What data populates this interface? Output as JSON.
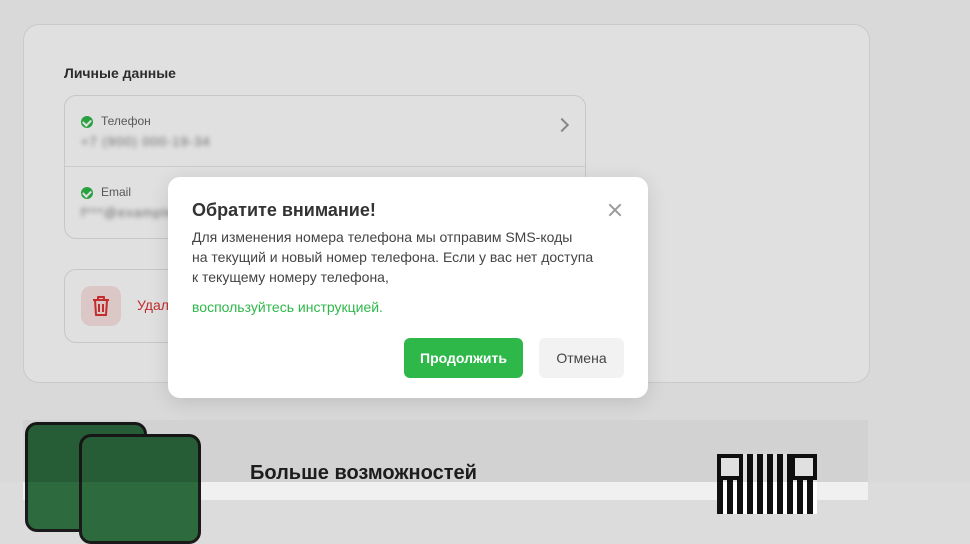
{
  "profile": {
    "section_title": "Личные данные",
    "phone": {
      "label": "Телефон",
      "value": "+7 (900) 000-19-34"
    },
    "email": {
      "label": "Email",
      "value": "f***@example.com"
    },
    "delete_label": "Удал"
  },
  "promo": {
    "title": "Больше возможностей"
  },
  "modal": {
    "title": "Обратите внимание!",
    "text_lines": [
      "Для изменения номера телефона мы отправим SMS-коды",
      "на текущий и новый номер телефона. Если у вас нет доступа",
      "к текущему номеру телефона,"
    ],
    "link": "воспользуйтесь инструкцией.",
    "continue_label": "Продолжить",
    "cancel_label": "Отмена"
  },
  "colors": {
    "accent": "#2fb84a",
    "danger": "#d33333"
  }
}
